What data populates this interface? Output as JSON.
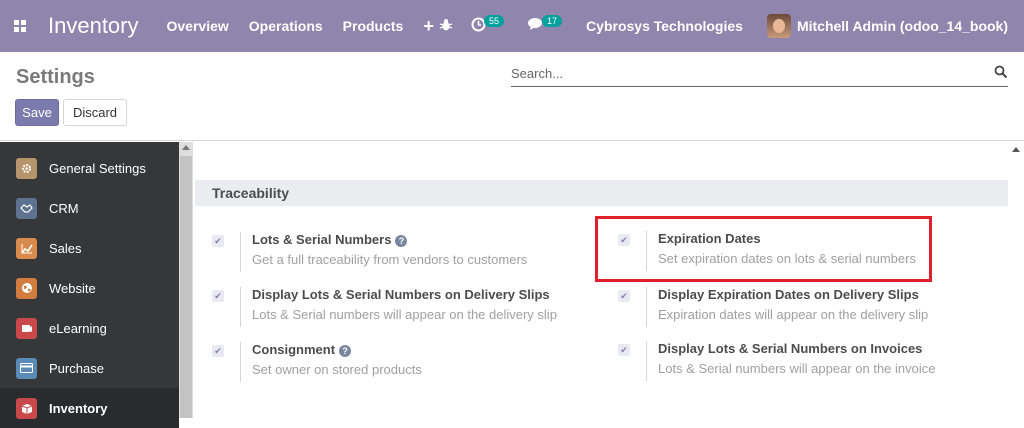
{
  "navbar": {
    "app_title": "Inventory",
    "menu": [
      "Overview",
      "Operations",
      "Products"
    ],
    "plus_label": "+",
    "activity_count": "55",
    "message_count": "17",
    "company": "Cybrosys Technologies",
    "user": "Mitchell Admin (odoo_14_book)"
  },
  "control_panel": {
    "title": "Settings",
    "search_placeholder": "Search...",
    "save_label": "Save",
    "discard_label": "Discard"
  },
  "sidebar": {
    "items": [
      {
        "label": "General Settings",
        "icon": "gear-icon",
        "color": "#b6956d"
      },
      {
        "label": "CRM",
        "icon": "handshake-icon",
        "color": "#5d7390"
      },
      {
        "label": "Sales",
        "icon": "chart-icon",
        "color": "#d88b4c"
      },
      {
        "label": "Website",
        "icon": "globe-icon",
        "color": "#d37c3f"
      },
      {
        "label": "eLearning",
        "icon": "elearning-icon",
        "color": "#c9494b"
      },
      {
        "label": "Purchase",
        "icon": "credit-card-icon",
        "color": "#5a8bb7"
      },
      {
        "label": "Inventory",
        "icon": "box-icon",
        "color": "#c9494b"
      }
    ]
  },
  "section": {
    "title": "Traceability",
    "settings": [
      {
        "title": "Lots & Serial Numbers",
        "desc": "Get a full traceability from vendors to customers",
        "help": true,
        "checked": true
      },
      {
        "title": "Expiration Dates",
        "desc": "Set expiration dates on lots & serial numbers",
        "help": false,
        "checked": true
      },
      {
        "title": "Display Lots & Serial Numbers on Delivery Slips",
        "desc": "Lots & Serial numbers will appear on the delivery slip",
        "help": false,
        "checked": true
      },
      {
        "title": "Display Expiration Dates on Delivery Slips",
        "desc": "Expiration dates will appear on the delivery slip",
        "help": false,
        "checked": true
      },
      {
        "title": "Consignment",
        "desc": "Set owner on stored products",
        "help": true,
        "checked": true
      },
      {
        "title": "Display Lots & Serial Numbers on Invoices",
        "desc": "Lots & Serial numbers will appear on the invoice",
        "help": false,
        "checked": true
      }
    ]
  },
  "colors": {
    "navbar": "#8f85ad",
    "save_button": "#7c7bad",
    "highlight": "#e0202c"
  }
}
